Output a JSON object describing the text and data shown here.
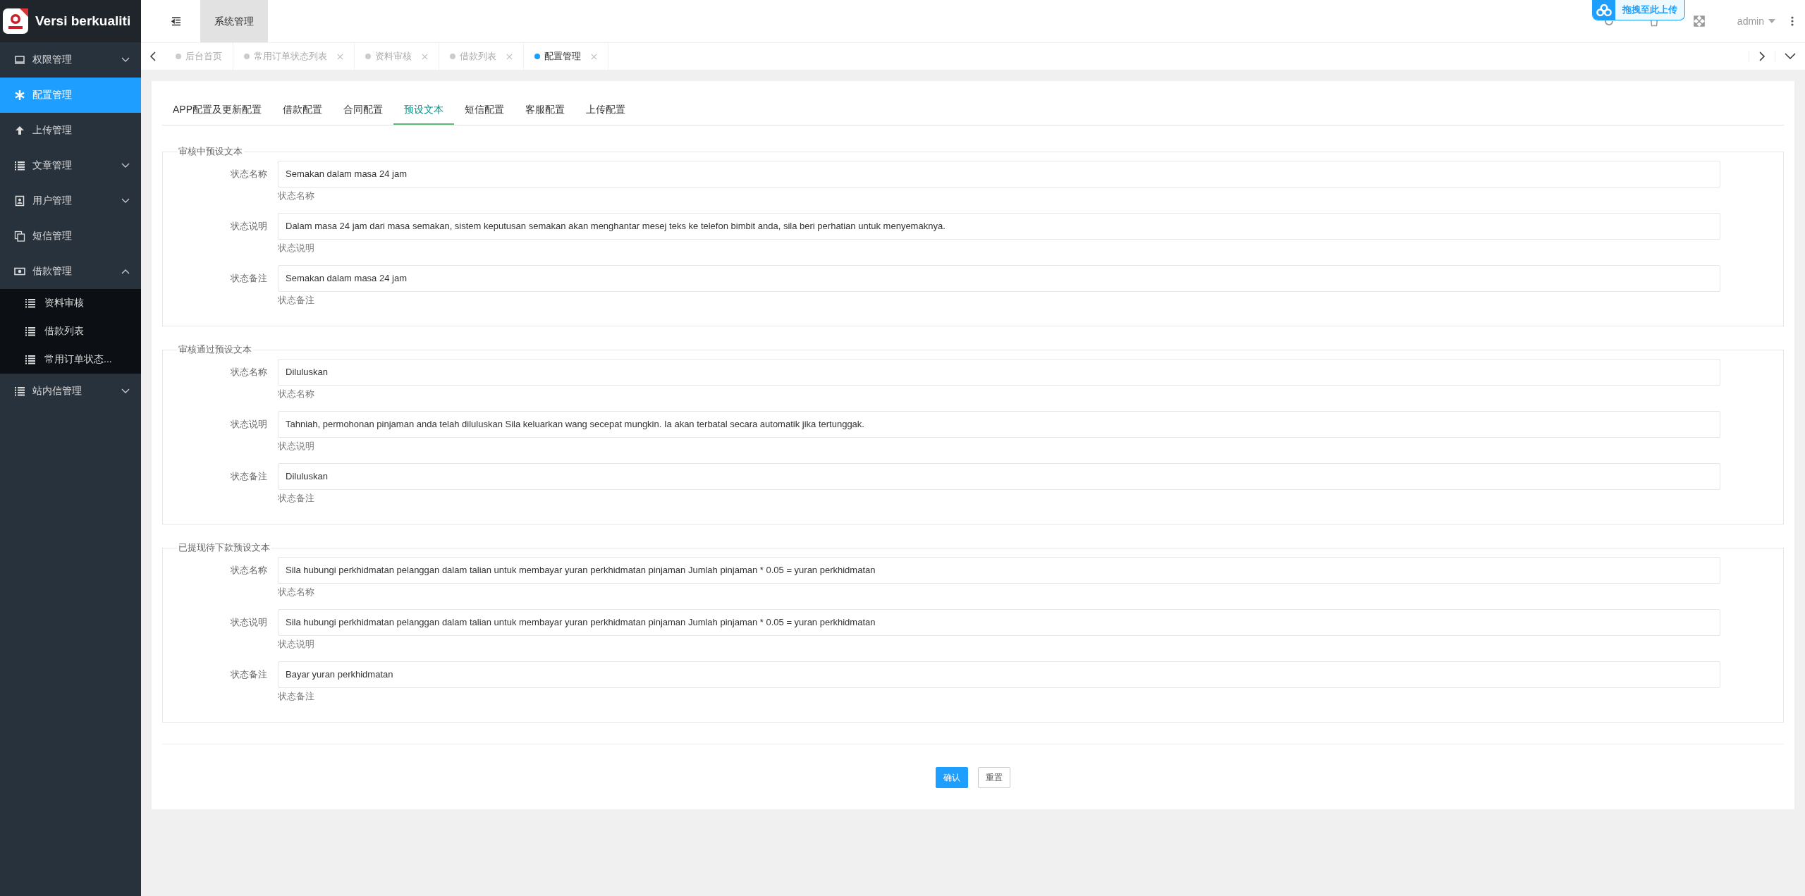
{
  "brand": {
    "title": "Versi berkualiti"
  },
  "header": {
    "nav": [
      {
        "label": "系统管理",
        "selected": true
      }
    ],
    "user": "admin"
  },
  "upload_overlay": {
    "label": "拖拽至此上传"
  },
  "sidebar": {
    "items": [
      {
        "kind": "group",
        "label": "权限管理",
        "selected": false,
        "expanded": false
      },
      {
        "kind": "link",
        "label": "配置管理",
        "selected": true
      },
      {
        "kind": "link",
        "label": "上传管理",
        "selected": false
      },
      {
        "kind": "group",
        "label": "文章管理",
        "selected": false,
        "expanded": false
      },
      {
        "kind": "group",
        "label": "用户管理",
        "selected": false,
        "expanded": false
      },
      {
        "kind": "link",
        "label": "短信管理",
        "selected": false
      },
      {
        "kind": "group",
        "label": "借款管理",
        "selected": false,
        "expanded": true,
        "children": [
          {
            "label": "资料审核",
            "selected": false
          },
          {
            "label": "借款列表",
            "selected": false
          },
          {
            "label": "常用订单状态...",
            "selected": false
          }
        ]
      },
      {
        "kind": "group",
        "label": "站内信管理",
        "selected": false,
        "expanded": false
      }
    ]
  },
  "page_tabs": [
    {
      "label": "后台首页",
      "selected": false,
      "closable": false
    },
    {
      "label": "常用订单状态列表",
      "selected": false,
      "closable": true
    },
    {
      "label": "资料审核",
      "selected": false,
      "closable": true
    },
    {
      "label": "借款列表",
      "selected": false,
      "closable": true
    },
    {
      "label": "配置管理",
      "selected": true,
      "closable": true
    }
  ],
  "config_tabs": [
    {
      "label": "APP配置及更新配置",
      "selected": false
    },
    {
      "label": "借款配置",
      "selected": false
    },
    {
      "label": "合同配置",
      "selected": false
    },
    {
      "label": "预设文本",
      "selected": true
    },
    {
      "label": "短信配置",
      "selected": false
    },
    {
      "label": "客服配置",
      "selected": false
    },
    {
      "label": "上传配置",
      "selected": false
    }
  ],
  "sections": [
    {
      "legend": "审核中预设文本",
      "fields": [
        {
          "label": "状态名称",
          "value": "Semakan dalam masa 24 jam",
          "hint": "状态名称"
        },
        {
          "label": "状态说明",
          "value": "Dalam masa 24 jam dari masa semakan, sistem keputusan semakan akan menghantar mesej teks ke telefon bimbit anda, sila beri perhatian untuk menyemaknya.",
          "hint": "状态说明"
        },
        {
          "label": "状态备注",
          "value": "Semakan dalam masa 24 jam",
          "hint": "状态备注"
        }
      ]
    },
    {
      "legend": "审核通过预设文本",
      "fields": [
        {
          "label": "状态名称",
          "value": "Diluluskan",
          "hint": "状态名称"
        },
        {
          "label": "状态说明",
          "value": "Tahniah, permohonan pinjaman anda telah diluluskan Sila keluarkan wang secepat mungkin. Ia akan terbatal secara automatik jika tertunggak.",
          "hint": "状态说明"
        },
        {
          "label": "状态备注",
          "value": "Diluluskan",
          "hint": "状态备注"
        }
      ]
    },
    {
      "legend": "已提现待下款预设文本",
      "fields": [
        {
          "label": "状态名称",
          "value": "Sila hubungi perkhidmatan pelanggan dalam talian untuk membayar yuran perkhidmatan pinjaman Jumlah pinjaman * 0.05 = yuran perkhidmatan",
          "hint": "状态名称"
        },
        {
          "label": "状态说明",
          "value": "Sila hubungi perkhidmatan pelanggan dalam talian untuk membayar yuran perkhidmatan pinjaman Jumlah pinjaman * 0.05 = yuran perkhidmatan",
          "hint": "状态说明"
        },
        {
          "label": "状态备注",
          "value": "Bayar yuran perkhidmatan",
          "hint": "状态备注"
        }
      ]
    }
  ],
  "buttons": [
    {
      "kind": "primary",
      "label": "确认"
    },
    {
      "kind": "secondary",
      "label": "重置"
    }
  ]
}
